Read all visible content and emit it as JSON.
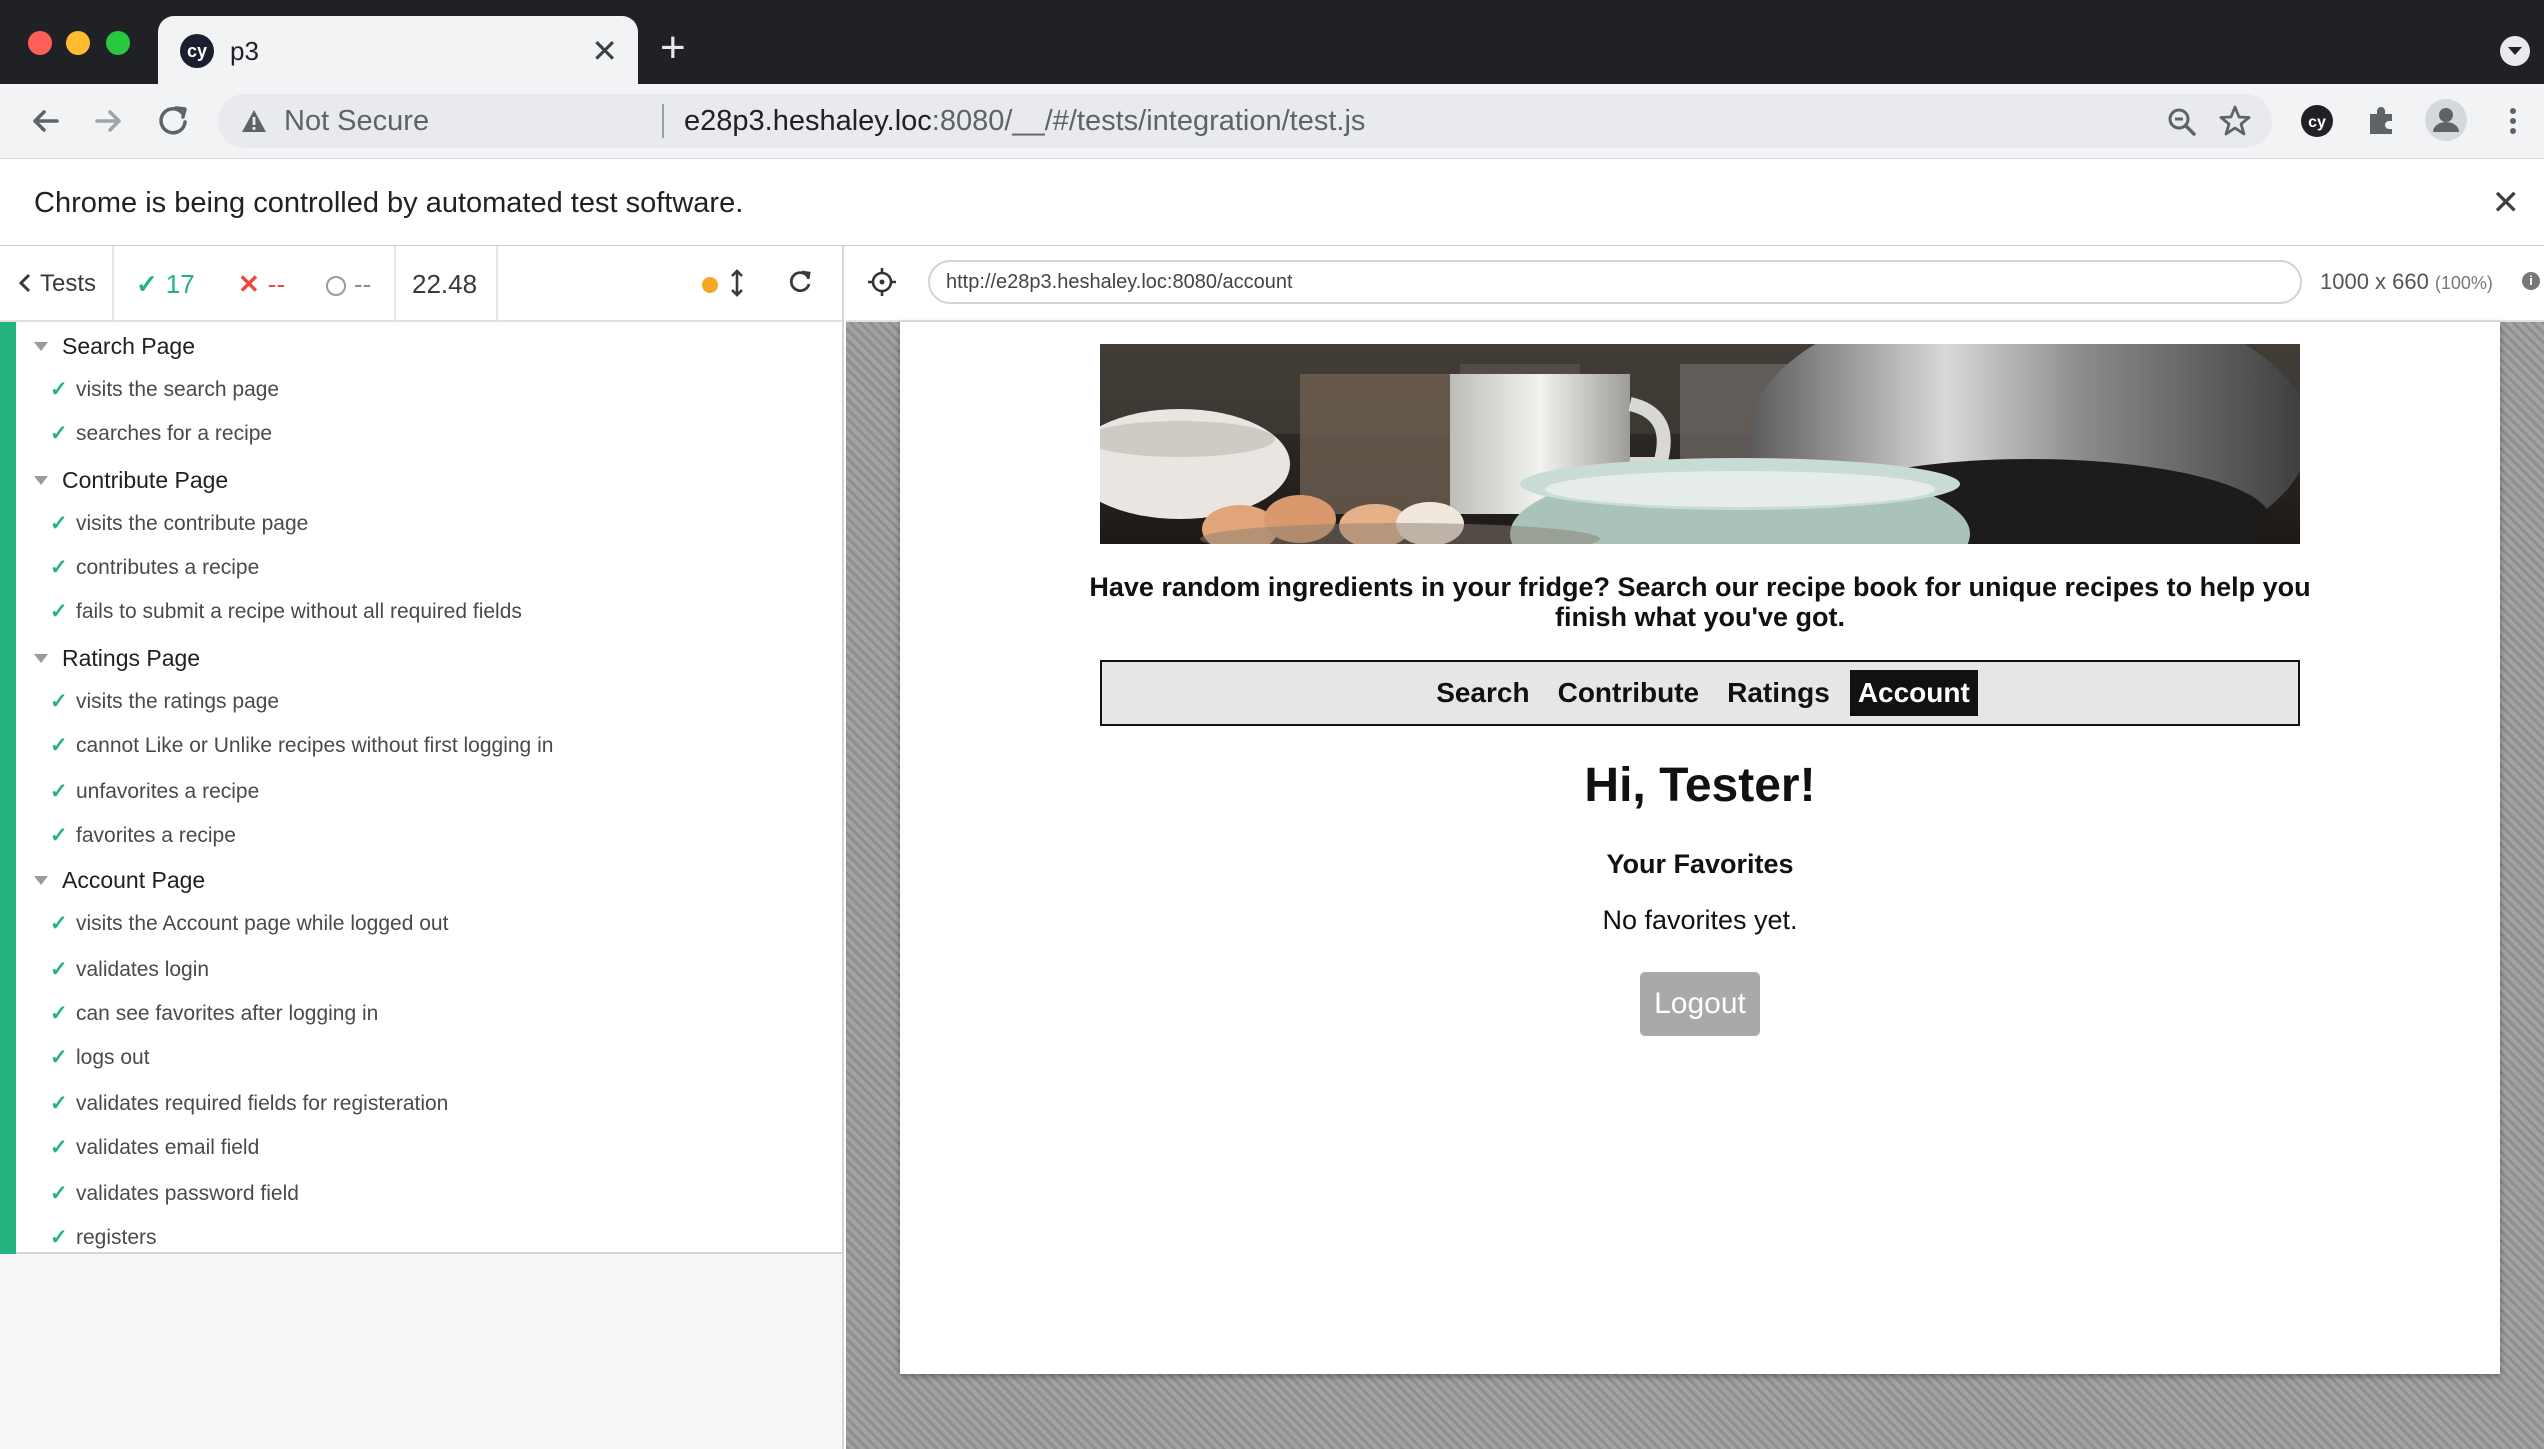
{
  "browser": {
    "tab_title": "p3",
    "tab_favicon": "cy",
    "new_tab_label": "+",
    "not_secure": "Not Secure",
    "url_host": "e28p3.heshaley.loc",
    "url_rest": ":8080/__/#/tests/integration/test.js",
    "infobar_text": "Chrome is being controlled by automated test software."
  },
  "reporter": {
    "tests_label": "Tests",
    "passed": "17",
    "failed": "--",
    "pending": "--",
    "duration": "22.48",
    "suites": [
      {
        "title": "Search Page",
        "tests": [
          "visits the search page",
          "searches for a recipe"
        ]
      },
      {
        "title": "Contribute Page",
        "tests": [
          "visits the contribute page",
          "contributes a recipe",
          "fails to submit a recipe without all required fields"
        ]
      },
      {
        "title": "Ratings Page",
        "tests": [
          "visits the ratings page",
          "cannot Like or Unlike recipes without first logging in",
          "unfavorites a recipe",
          "favorites a recipe"
        ]
      },
      {
        "title": "Account Page",
        "tests": [
          "visits the Account page while logged out",
          "validates login",
          "can see favorites after logging in",
          "logs out",
          "validates required fields for registeration",
          "validates email field",
          "validates password field",
          "registers"
        ]
      }
    ]
  },
  "aut": {
    "url": "http://e28p3.heshaley.loc:8080/account",
    "size": "1000 x 660",
    "scale": "(100%)"
  },
  "app": {
    "tagline": "Have random ingredients in your fridge? Search our recipe book for unique recipes to help you finish what you've got.",
    "nav": [
      "Search",
      "Contribute",
      "Ratings",
      "Account"
    ],
    "greeting": "Hi, Tester!",
    "favorites_title": "Your Favorites",
    "favorites_empty": "No favorites yet.",
    "logout_label": "Logout"
  },
  "colors": {
    "pass": "#24b37e",
    "fail": "#e94b3c",
    "pending_dot": "#f5a623"
  }
}
